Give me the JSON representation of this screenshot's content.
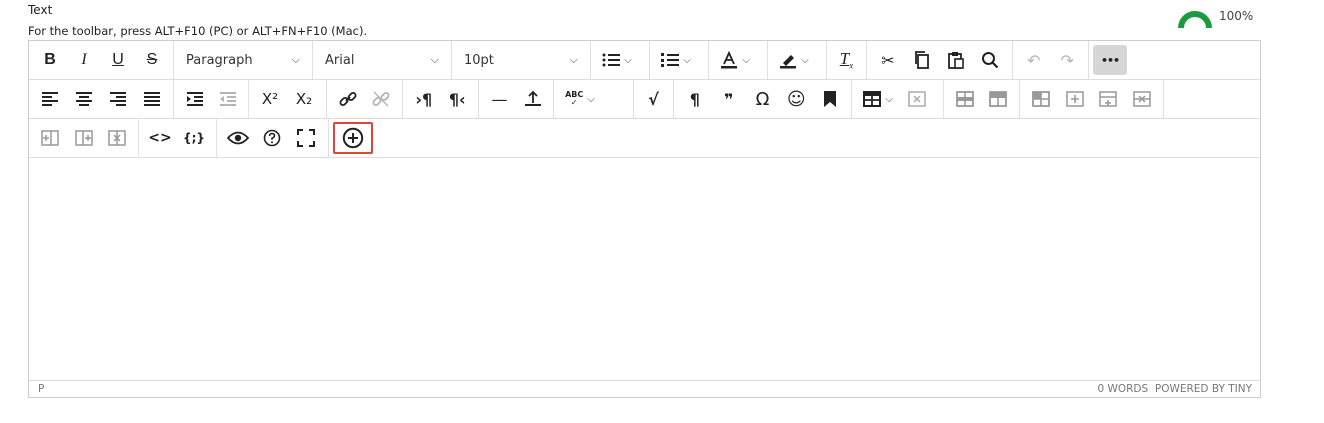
{
  "field": {
    "label": "Text",
    "hint": "For the toolbar, press ALT+F10 (PC) or ALT+FN+F10 (Mac).",
    "progress_percent": 100,
    "progress_label": "100%"
  },
  "toolbar": {
    "bold": "B",
    "italic": "I",
    "underline": "U",
    "strike": "S",
    "block_format": "Paragraph",
    "font_family": "Arial",
    "font_size": "10pt",
    "superscript": "X²",
    "subscript": "X₂",
    "horizontal_line": "—",
    "pilcrow": "¶",
    "quote": "❞",
    "omega": "Ω",
    "code": "<>",
    "template": "{;}",
    "more": "•••"
  },
  "statusbar": {
    "path": "P",
    "words": "0 WORDS",
    "powered": "POWERED BY TINY"
  },
  "colors": {
    "highlight_border": "#e0453a",
    "gauge": "#1a9c3e"
  }
}
